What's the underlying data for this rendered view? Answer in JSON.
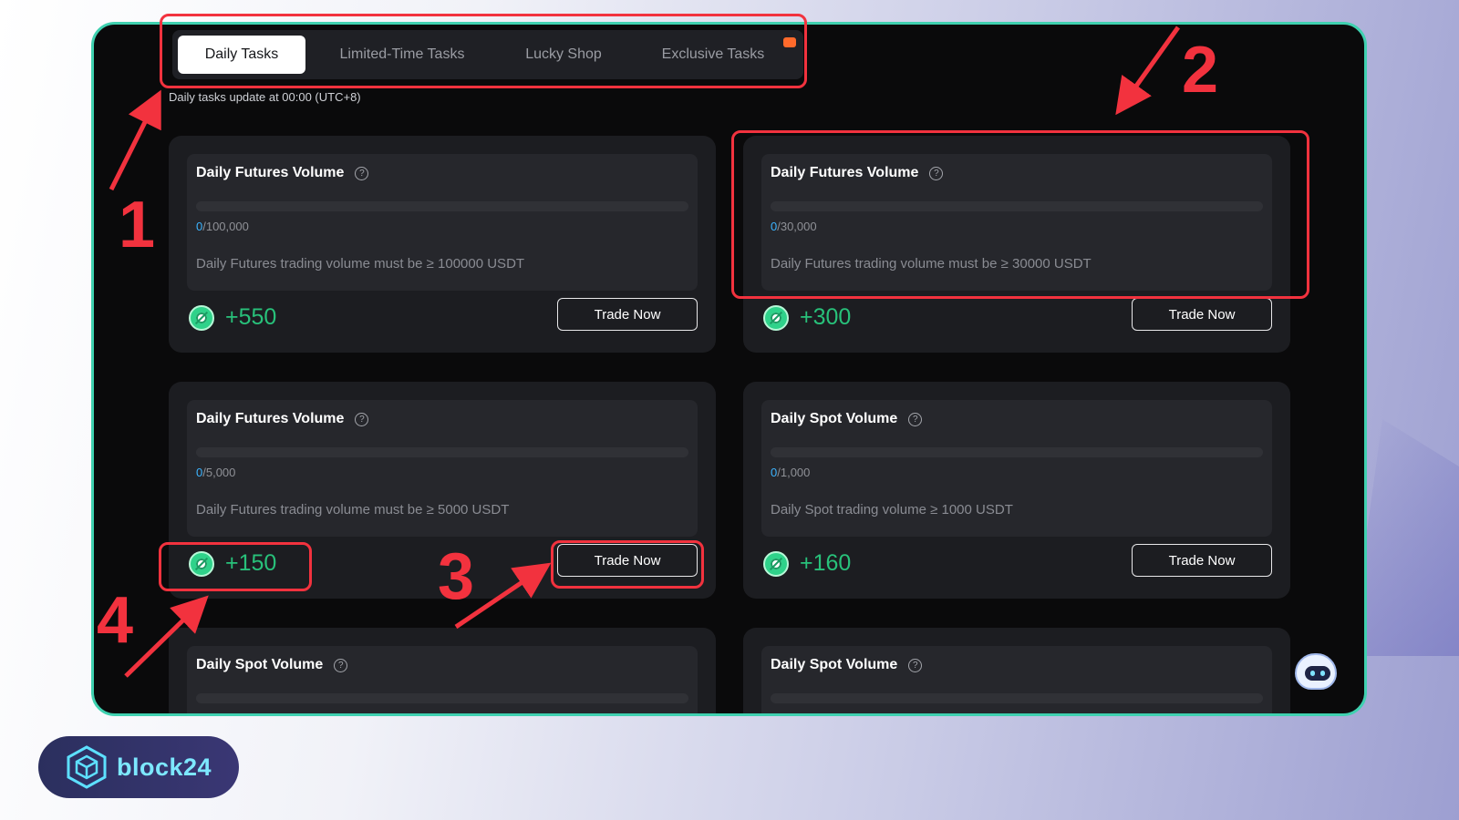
{
  "tabs": [
    {
      "label": "Daily Tasks",
      "active": true
    },
    {
      "label": "Limited-Time Tasks",
      "active": false
    },
    {
      "label": "Lucky Shop",
      "active": false
    },
    {
      "label": "Exclusive Tasks",
      "active": false
    }
  ],
  "note": "Daily tasks update at 00:00 (UTC+8)",
  "help_glyph": "?",
  "tasks": [
    {
      "title": "Daily Futures Volume",
      "current": "0",
      "target": "/100,000",
      "desc": "Daily Futures trading volume must be ≥ 100000 USDT",
      "reward": "+550",
      "button": "Trade Now"
    },
    {
      "title": "Daily Futures Volume",
      "current": "0",
      "target": "/30,000",
      "desc": "Daily Futures trading volume must be ≥ 30000 USDT",
      "reward": "+300",
      "button": "Trade Now"
    },
    {
      "title": "Daily Futures Volume",
      "current": "0",
      "target": "/5,000",
      "desc": "Daily Futures trading volume must be ≥ 5000 USDT",
      "reward": "+150",
      "button": "Trade Now"
    },
    {
      "title": "Daily Spot Volume",
      "current": "0",
      "target": "/1,000",
      "desc": "Daily Spot trading volume ≥ 1000 USDT",
      "reward": "+160",
      "button": "Trade Now"
    },
    {
      "title": "Daily Spot Volume"
    },
    {
      "title": "Daily Spot Volume"
    }
  ],
  "annotations": {
    "n1": "1",
    "n2": "2",
    "n3": "3",
    "n4": "4"
  },
  "logo": {
    "text": "block24"
  },
  "colors": {
    "accent_green": "#28c17a",
    "frame": "#3fd1b0",
    "annotation": "#f2323e",
    "progress_current": "#3cb4ff"
  }
}
